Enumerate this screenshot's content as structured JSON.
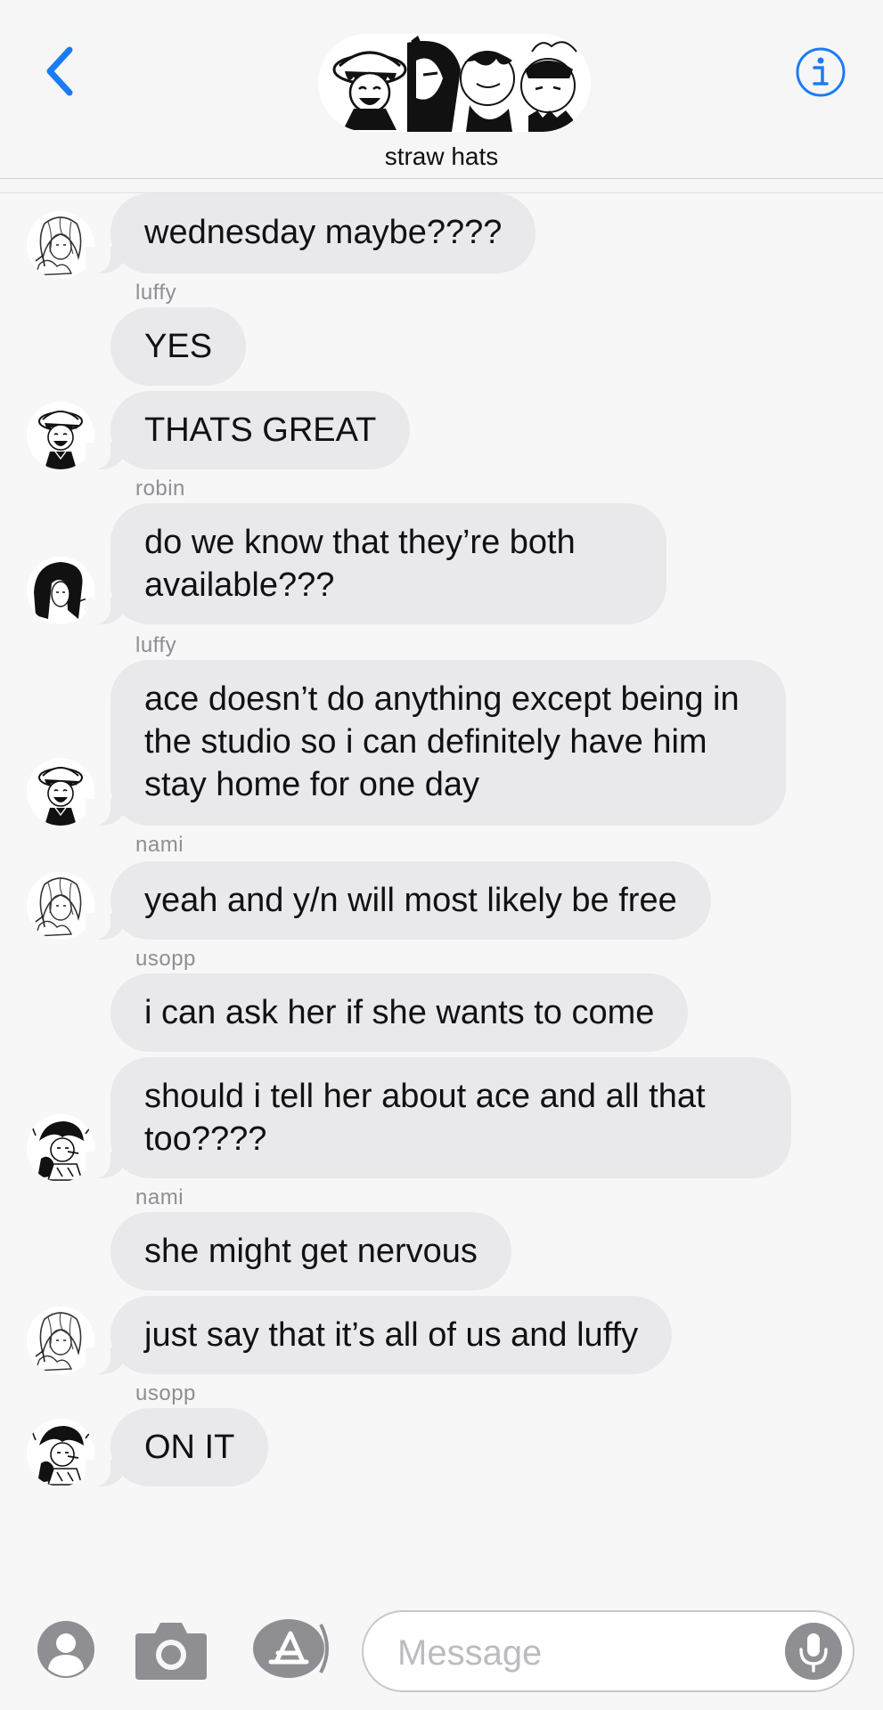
{
  "header": {
    "group_name": "straw hats",
    "back_icon": "chevron-left-icon",
    "info_icon": "info-icon",
    "accent": "#1a7cf5"
  },
  "messages": [
    {
      "sender": "",
      "text": "wednesday maybe????",
      "avatar": "nami"
    },
    {
      "sender": "luffy",
      "text": "YES",
      "avatar": ""
    },
    {
      "sender": "",
      "text": "THATS GREAT",
      "avatar": "luffy"
    },
    {
      "sender": "robin",
      "text": "do we know that they’re both available???",
      "avatar": "robin"
    },
    {
      "sender": "luffy",
      "text": "ace doesn’t do anything except being in the studio so i can definitely have him stay home for one day",
      "avatar": "luffy"
    },
    {
      "sender": "nami",
      "text": "yeah and y/n will most likely be free",
      "avatar": "nami"
    },
    {
      "sender": "usopp",
      "text": "i can ask her if she wants to come",
      "avatar": ""
    },
    {
      "sender": "",
      "text": "should i tell her about ace and all that too????",
      "avatar": "usopp"
    },
    {
      "sender": "nami",
      "text": "she might get nervous",
      "avatar": ""
    },
    {
      "sender": "",
      "text": "just say that it’s all of us and luffy",
      "avatar": "nami"
    },
    {
      "sender": "usopp",
      "text": "ON IT",
      "avatar": "usopp"
    }
  ],
  "composer": {
    "placeholder": "Message",
    "icons": [
      "contact-icon",
      "camera-icon",
      "app-store-icon",
      "microphone-icon"
    ]
  },
  "colors": {
    "bubble": "#e9e9ec",
    "background": "#f7f7f8",
    "sender_label": "#8e8e93"
  }
}
